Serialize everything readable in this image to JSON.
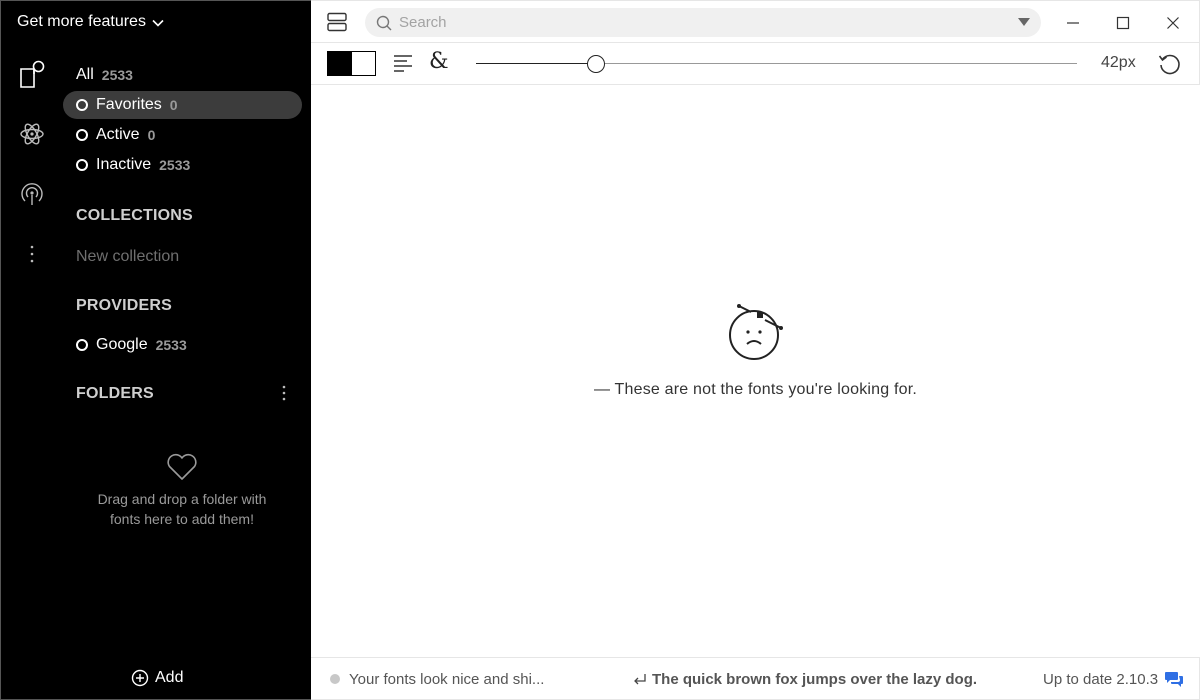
{
  "sidebar": {
    "features_label": "Get more features",
    "rail": [
      {
        "icon": "library-icon"
      },
      {
        "icon": "atom-icon"
      },
      {
        "icon": "broadcast-icon"
      },
      {
        "icon": "more-vertical-icon"
      }
    ],
    "filters": [
      {
        "label": "All",
        "count": "2533",
        "selected": false
      },
      {
        "label": "Favorites",
        "count": "0",
        "selected": true
      },
      {
        "label": "Active",
        "count": "0",
        "selected": false
      },
      {
        "label": "Inactive",
        "count": "2533",
        "selected": false
      }
    ],
    "collections": {
      "title": "COLLECTIONS",
      "new_label": "New collection"
    },
    "providers": {
      "title": "PROVIDERS",
      "items": [
        {
          "label": "Google",
          "count": "2533"
        }
      ]
    },
    "folders": {
      "title": "FOLDERS",
      "drop_text": "Drag and drop a folder with fonts here to add them!"
    },
    "add_label": "Add"
  },
  "topbar": {
    "search_placeholder": "Search"
  },
  "toolbar": {
    "glyph": "&",
    "size_value": 42,
    "size_fraction": 0.2,
    "size_label": "42px"
  },
  "main": {
    "empty_message": "— These are not the fonts you're looking for."
  },
  "statusbar": {
    "message": "Your fonts look nice and shi...",
    "preview_text": "The quick brown fox jumps over the lazy dog.",
    "version_text": "Up to date 2.10.3"
  },
  "colors": {
    "sidebar_bg": "#000000",
    "selected_bg": "#3c3c3c",
    "accent_blue": "#2f6fe4"
  }
}
